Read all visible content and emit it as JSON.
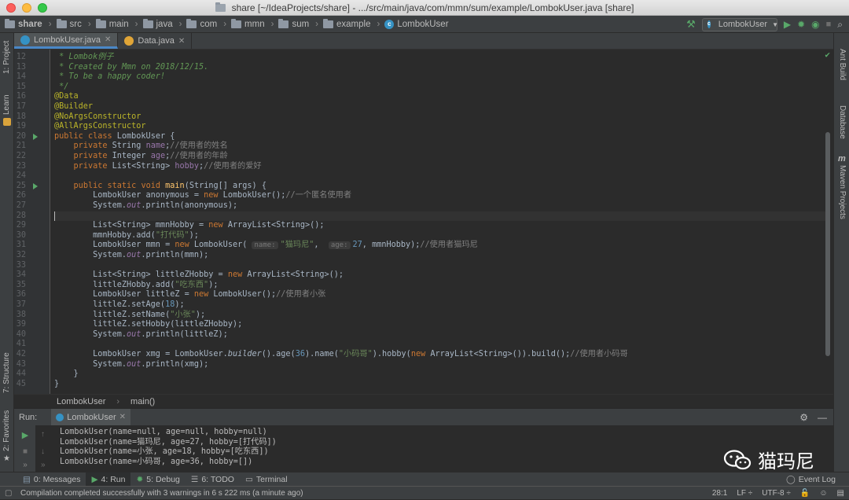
{
  "window": {
    "title": "share [~/IdeaProjects/share] - .../src/main/java/com/mmn/sum/example/LombokUser.java [share]"
  },
  "breadcrumb": [
    {
      "label": "share",
      "icon": "folder-icon"
    },
    {
      "label": "src",
      "icon": "folder-icon"
    },
    {
      "label": "main",
      "icon": "folder-icon"
    },
    {
      "label": "java",
      "icon": "folder-icon"
    },
    {
      "label": "com",
      "icon": "folder-icon"
    },
    {
      "label": "mmn",
      "icon": "folder-icon"
    },
    {
      "label": "sum",
      "icon": "folder-icon"
    },
    {
      "label": "example",
      "icon": "folder-icon"
    },
    {
      "label": "LombokUser",
      "icon": "class-icon"
    }
  ],
  "toolbar": {
    "run_config": "LombokUser"
  },
  "tabs": [
    {
      "label": "LombokUser.java",
      "active": true
    },
    {
      "label": "Data.java",
      "active": false
    }
  ],
  "left_tools": {
    "project": "1: Project",
    "learn": "Learn",
    "structure": "7: Structure",
    "favorites": "2: Favorites"
  },
  "right_tools": {
    "ant": "Ant Build",
    "database": "Database",
    "maven": "Maven Projects"
  },
  "code": {
    "lines": [
      "12",
      "13",
      "14",
      "15",
      "16",
      "17",
      "18",
      "19",
      "20",
      "21",
      "22",
      "23",
      "24",
      "25",
      "26",
      "27",
      "28",
      "29",
      "30",
      "31",
      "32",
      "33",
      "34",
      "35",
      "36",
      "37",
      "38",
      "39",
      "40",
      "41",
      "42",
      "43",
      "44",
      "45"
    ],
    "cm12": " * Lombok例子",
    "cm13": " * Created by Mmn on 2018/12/15.",
    "cm14": " * To be a happy coder!",
    "cm15": " */",
    "an16": "@Data",
    "an17": "@Builder",
    "an18": "@NoArgsConstructor",
    "an19": "@AllArgsConstructor",
    "kw_public": "public",
    "kw_class": "class",
    "class_name": " LombokUser {",
    "kw_private": "private",
    "f_name": "name",
    "c_name": "//使用者的姓名",
    "f_age": "age",
    "c_age": "//使用者的年龄",
    "f_hobby": "hobby",
    "c_hobby": "//使用者的爱好",
    "kw_static": "static",
    "kw_void": "void",
    "kw_new": "new",
    "main_name": "main",
    "main_sig": "(String[] args) {",
    "c_anon": "//一个匿名使用者",
    "s_daima": "\"打代码\"",
    "hint_name": "name:",
    "hint_age": "age:",
    "s_maomani": "\"猫玛尼\"",
    "n_27": "27",
    "c_mmn": "//使用者猫玛尼",
    "s_chi": "\"吃东西\"",
    "c_xiaozhang": "//使用者小张",
    "n_18": "18",
    "s_xiaozhang": "\"小张\"",
    "n_36": "36",
    "s_xiaomage": "\"小码哥\"",
    "c_xiaomage": "//使用者小码哥",
    "builder": "builder",
    "out": "out"
  },
  "editor_breadcrumb": {
    "class": "LombokUser",
    "method": "main()"
  },
  "run": {
    "label": "Run:",
    "tab": "LombokUser",
    "output": [
      "LombokUser(name=null, age=null, hobby=null)",
      "LombokUser(name=猫玛尼, age=27, hobby=[打代码])",
      "LombokUser(name=小张, age=18, hobby=[吃东西])",
      "LombokUser(name=小码哥, age=36, hobby=[])"
    ]
  },
  "watermark": "猫玛尼",
  "bottom_tools": [
    {
      "label": "0: Messages",
      "active": false
    },
    {
      "label": "4: Run",
      "active": true
    },
    {
      "label": "5: Debug",
      "active": false
    },
    {
      "label": "6: TODO",
      "active": false
    },
    {
      "label": "Terminal",
      "active": false
    }
  ],
  "event_log": "Event Log",
  "status": {
    "message": "Compilation completed successfully with 3 warnings in 6 s 222 ms (a minute ago)",
    "position": "28:1",
    "line_sep": "LF ÷",
    "encoding": "UTF-8 ÷"
  }
}
